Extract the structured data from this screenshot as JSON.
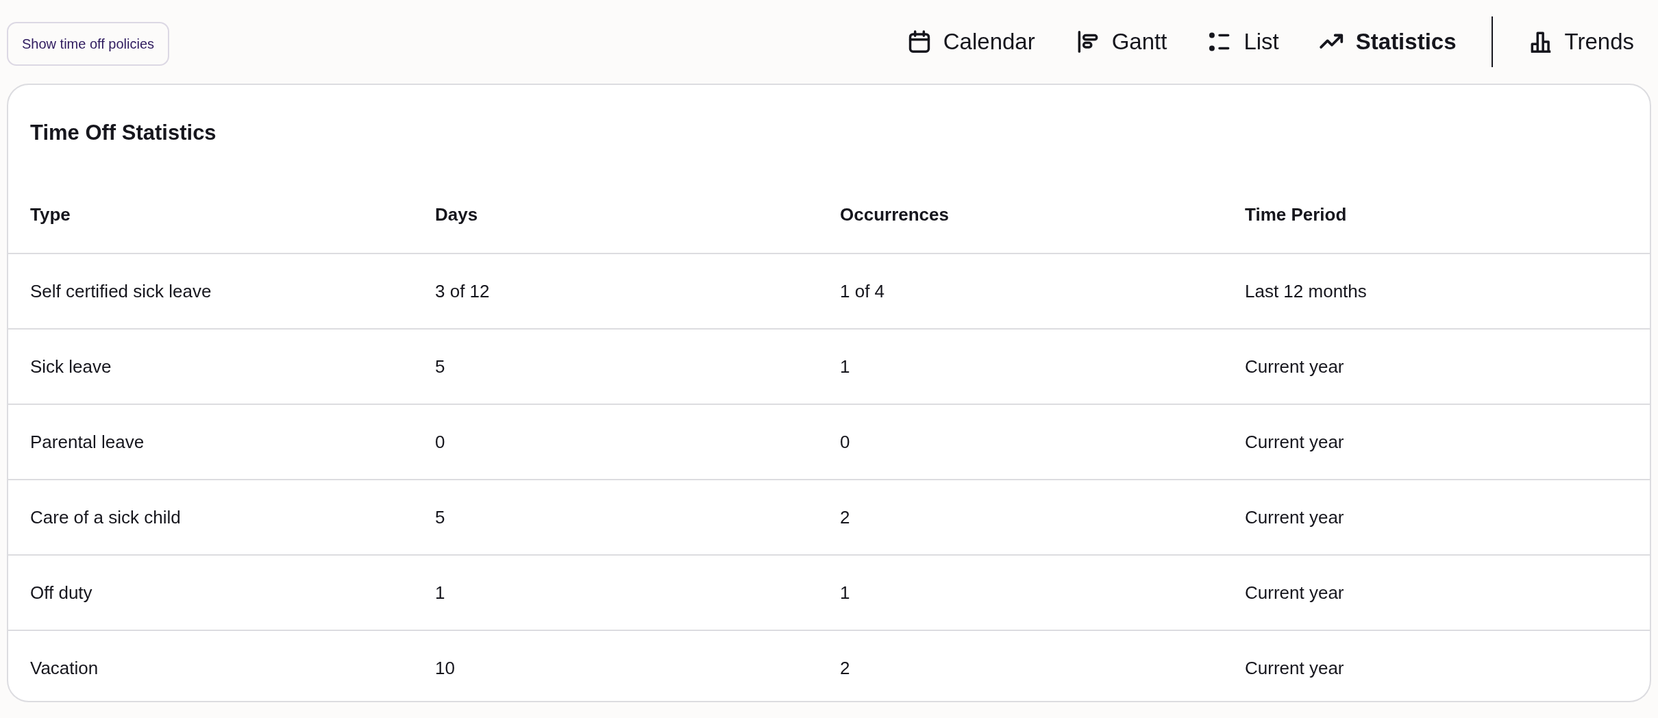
{
  "policies_button": {
    "label": "Show time off policies"
  },
  "views": [
    {
      "label": "Calendar",
      "selected": false
    },
    {
      "label": "Gantt",
      "selected": false
    },
    {
      "label": "List",
      "selected": false
    },
    {
      "label": "Statistics",
      "selected": true
    }
  ],
  "trends": {
    "label": "Trends"
  },
  "card": {
    "title": "Time Off Statistics",
    "columns": [
      "Type",
      "Days",
      "Occurrences",
      "Time Period"
    ],
    "rows": [
      [
        "Self certified sick leave",
        "3 of 12",
        "1 of 4",
        "Last 12 months"
      ],
      [
        "Sick leave",
        "5",
        "1",
        "Current year"
      ],
      [
        "Parental leave",
        "0",
        "0",
        "Current year"
      ],
      [
        "Care of a sick child",
        "5",
        "2",
        "Current year"
      ],
      [
        "Off duty",
        "1",
        "1",
        "Current year"
      ],
      [
        "Vacation",
        "10",
        "2",
        "Current year"
      ]
    ]
  }
}
